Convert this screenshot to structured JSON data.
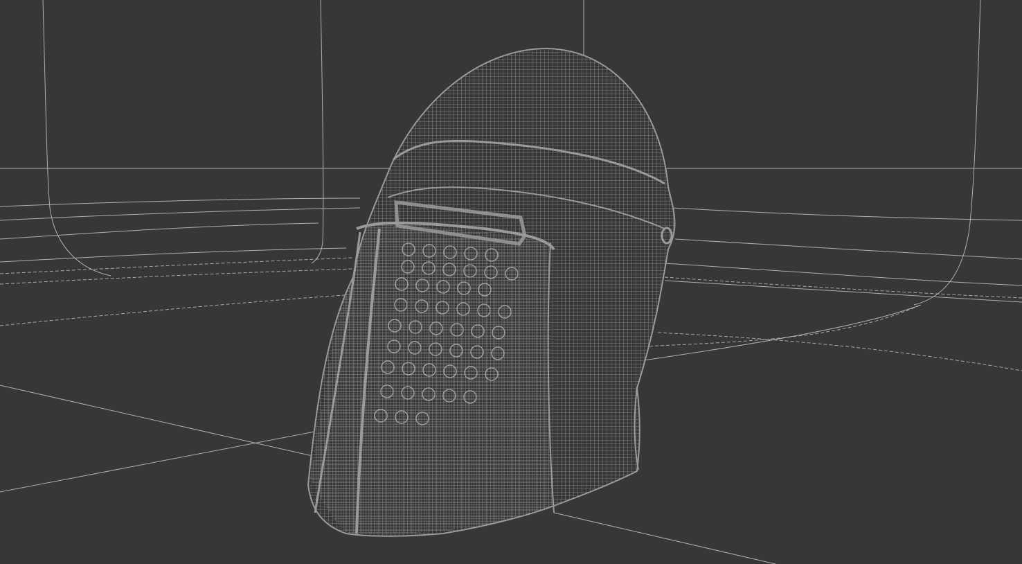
{
  "viewport": {
    "background_color": "#373737",
    "wire_color": "#8a8a8a",
    "grid_color": "#bdbdbd",
    "shading": "wireframe"
  },
  "scene": {
    "object": "helmet-mesh"
  }
}
